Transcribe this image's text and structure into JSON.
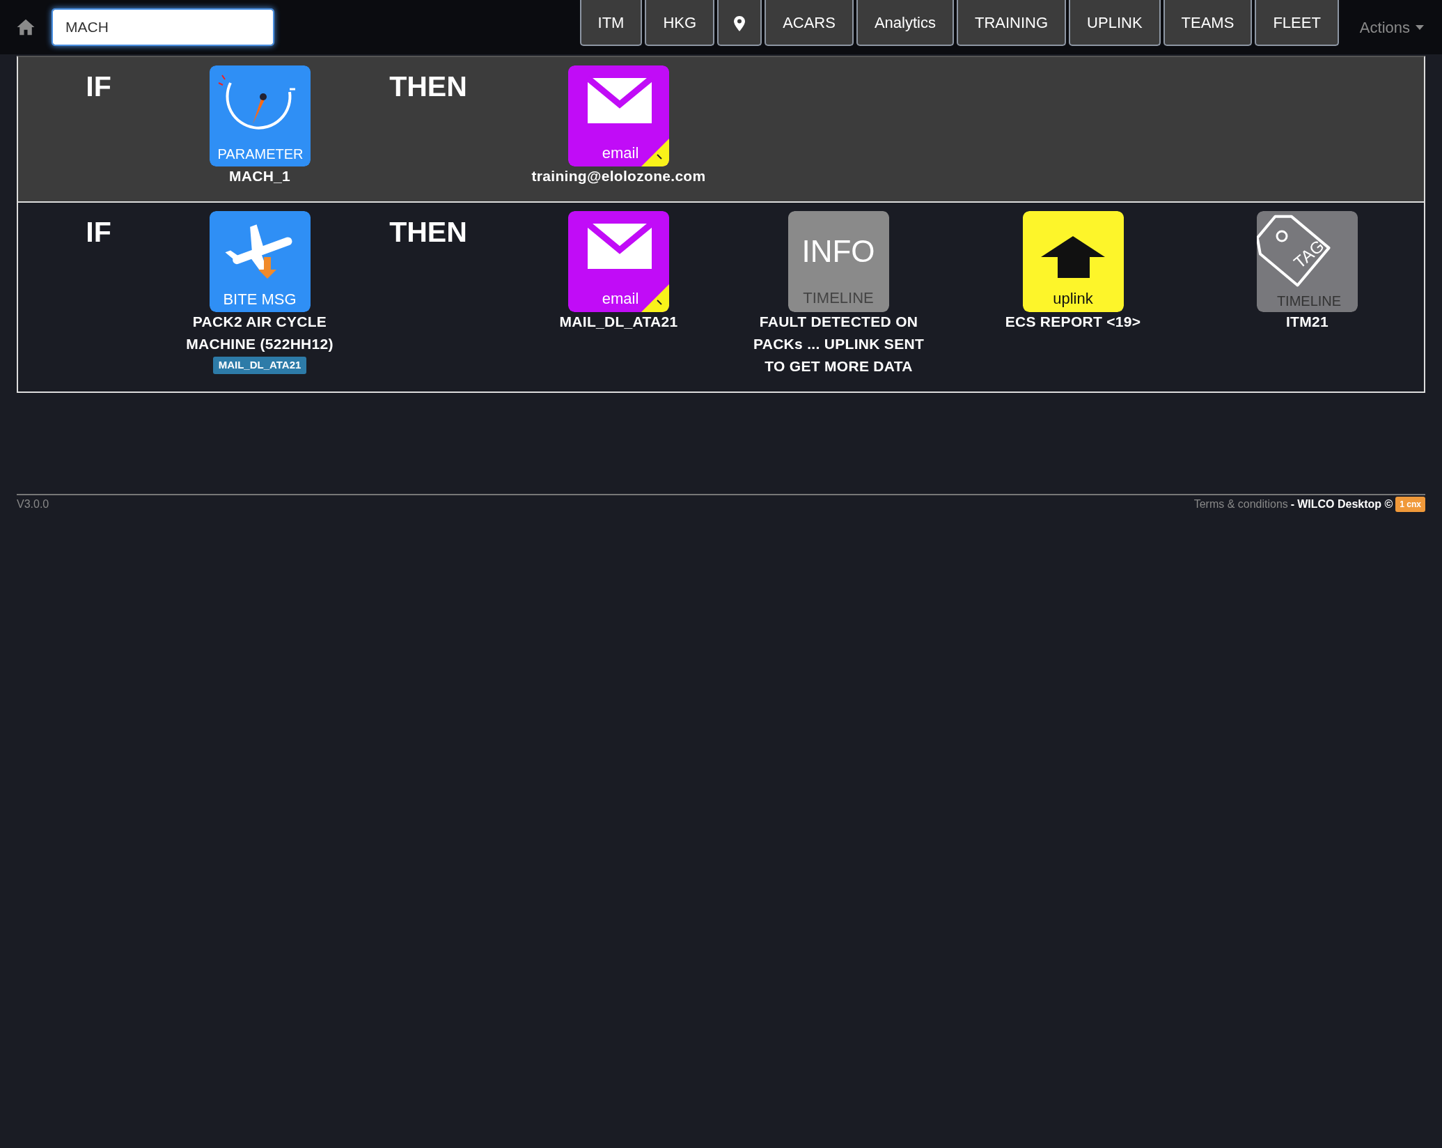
{
  "navbar": {
    "search": {
      "value": "MACH"
    },
    "buttons": [
      {
        "kind": "text",
        "label": "ITM"
      },
      {
        "kind": "text",
        "label": "HKG"
      },
      {
        "kind": "pin"
      },
      {
        "kind": "text",
        "label": "ACARS"
      },
      {
        "kind": "text",
        "label": "Analytics"
      },
      {
        "kind": "text",
        "label": "TRAINING"
      },
      {
        "kind": "text",
        "label": "UPLINK"
      },
      {
        "kind": "text",
        "label": "TEAMS"
      },
      {
        "kind": "text",
        "label": "FLEET"
      }
    ],
    "actions_menu": "Actions"
  },
  "rules": [
    {
      "selected": true,
      "if_label": "IF",
      "then_label": "THEN",
      "conditions": [
        {
          "kind": "parameter",
          "caption": "PARAMETER",
          "label": "MACH_1"
        }
      ],
      "actions": [
        {
          "kind": "email",
          "caption": "email",
          "label": "training@elolozone.com"
        }
      ]
    },
    {
      "selected": false,
      "if_label": "IF",
      "then_label": "THEN",
      "conditions": [
        {
          "kind": "bite",
          "caption": "BITE MSG",
          "label": "PACK2 AIR CYCLE MACHINE (522HH12)",
          "badge": "MAIL_DL_ATA21"
        }
      ],
      "actions": [
        {
          "kind": "email",
          "caption": "email",
          "label": "MAIL_DL_ATA21"
        },
        {
          "kind": "info",
          "glyph": "INFO",
          "caption": "TIMELINE",
          "label": "FAULT DETECTED ON PACKs ... UPLINK SENT TO GET MORE DATA"
        },
        {
          "kind": "uplink",
          "caption": "uplink",
          "label": "ECS REPORT <19>"
        },
        {
          "kind": "tag",
          "glyph": "TAG",
          "caption": "TIMELINE",
          "label": "ITM21"
        }
      ]
    }
  ],
  "footer": {
    "version": "V3.0.0",
    "terms_link": "Terms & conditions",
    "separator": "-",
    "product": "WILCO Desktop ©",
    "badge": "1 cnx"
  }
}
